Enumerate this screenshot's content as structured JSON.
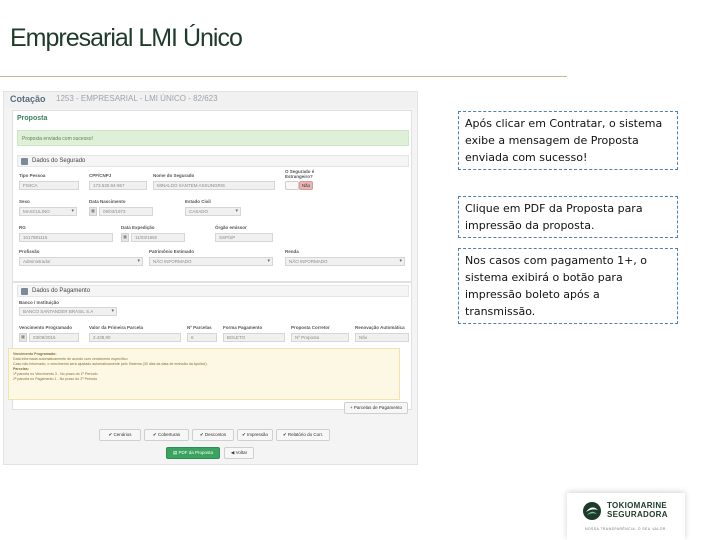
{
  "slide": {
    "title": "Empresarial LMI Único"
  },
  "screenshot": {
    "header": {
      "section": "Cotação",
      "quote": "1253 - EMPRESARIAL - LMI ÚNICO - 82/623"
    },
    "proposal": {
      "heading": "Proposta",
      "alert": "Proposta enviada com sucesso!"
    },
    "insured": {
      "heading": "Dados do Segurado",
      "fields": {
        "tipo_pessoa": {
          "label": "Tipo Pessoa",
          "value": "FISICA"
        },
        "cpf": {
          "label": "CPF/CNPJ",
          "value": "173.530.84-957"
        },
        "nome": {
          "label": "Nome do Segurado",
          "value": "MINALDO SANTEM ASSUNGRIS"
        },
        "segurado_estrangeiro": {
          "label": "O Segurado é Estrangeiro?",
          "value": "Não"
        },
        "sexo": {
          "label": "Sexo",
          "value": "MASCULINO"
        },
        "nascimento": {
          "label": "Data Nascimento",
          "value": "09/03/1973"
        },
        "estado_civil": {
          "label": "Estado Civil",
          "value": "CASADO"
        },
        "rg": {
          "label": "RG",
          "value": "1017881115"
        },
        "expedicao": {
          "label": "Data Expedição",
          "value": "11/03/1992"
        },
        "orgao": {
          "label": "Órgão emissor",
          "value": "SSP/SP"
        },
        "profissao": {
          "label": "Profissão",
          "value": "Administrador"
        },
        "patrimonio": {
          "label": "Patrimônio Estimado",
          "value": "NÃO INFORMADO"
        },
        "renda": {
          "label": "Renda",
          "value": "NÃO INFORMADO"
        }
      }
    },
    "payment": {
      "heading": "Dados do Pagamento",
      "bank_label": "Banco / Instituição",
      "bank_value": "BANCO SANTANDER BRASIL S.A",
      "fields": {
        "vencimento": {
          "label": "Vencimento Programado",
          "value": "03/08/2016"
        },
        "valor": {
          "label": "Valor da Primeira Parcela",
          "value": "2.438,90"
        },
        "parcelas": {
          "label": "Nº Parcelas",
          "value": "6"
        },
        "forma": {
          "label": "Forma Pagamento",
          "value": "BOLETO"
        },
        "corretor": {
          "label": "Proposta Corretor",
          "value": "Nº Proposta"
        },
        "renovacao": {
          "label": "Renovação Automática",
          "value": "Não"
        }
      },
      "notice": [
        "Vencimento Programado:",
        "Data informada automaticamente de acordo com vencimento específico.",
        "Caso não informado, o vencimento será ajustado automaticamente pelo Sistema (30 dias da data de emissão da Apólice).",
        "Parcelas:",
        "1ª parcela no Vencimento 3 - No prazo do 1º Período",
        "2ª parcela no Pagamento 1 - No prazo do 2º Período"
      ],
      "installments_button": "Parcelas de Pagamento"
    },
    "actions": {
      "scenario": "Cenários",
      "coverage": "Coberturas",
      "discount": "Descontos",
      "print": "Impressão",
      "report": "Relatório do Corr.",
      "pdf": "PDF da Proposta",
      "back": "Voltar"
    }
  },
  "notes": [
    "Após clicar em Contratar, o sistema exibe a mensagem de Proposta enviada com sucesso!",
    "Clique em PDF da Proposta para impressão da proposta.",
    "Nos casos com pagamento 1+, o sistema exibirá o botão para impressão boleto após a transmissão."
  ],
  "logo": {
    "line1": "TOKIOMARINE",
    "line2": "SEGURADORA",
    "tagline": "NOSSA TRANSPARÊNCIA. O SEU VALOR."
  },
  "colors": {
    "brand_green": "#3aa35f",
    "note_border": "#4f7fb3",
    "alert_green": "#dff0d8",
    "notice_yellow": "#fcf8e3"
  }
}
